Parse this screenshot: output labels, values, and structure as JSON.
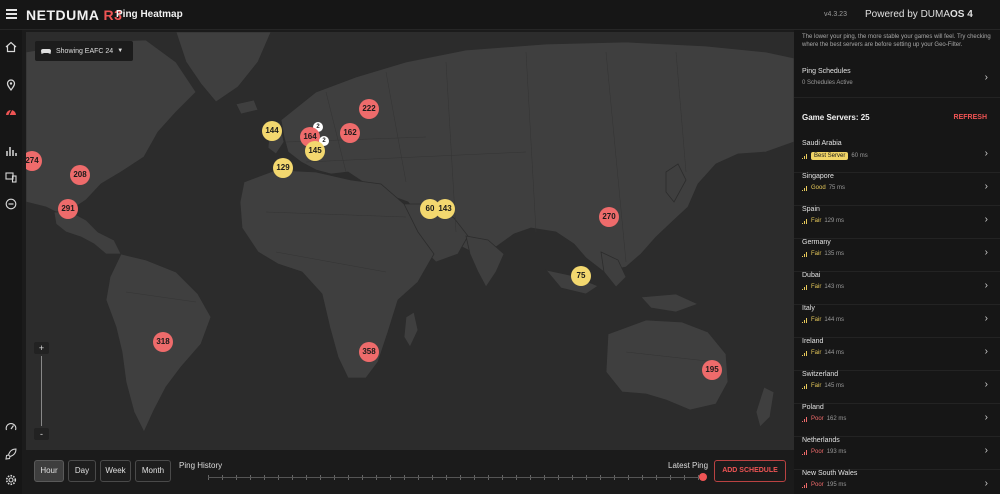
{
  "header": {
    "brand": "NETDUMA",
    "brand_model": "R3",
    "page_title": "Ping Heatmap",
    "version": "v4.3.23",
    "powered_prefix": "Powered by DUMA",
    "powered_os": "OS 4"
  },
  "map": {
    "game_selector": "Showing EAFC 24",
    "zoom_in": "+",
    "zoom_out": "-",
    "markers": [
      {
        "label": "222",
        "level": "poor"
      },
      {
        "label": "144",
        "level": "fair"
      },
      {
        "label": "2",
        "level": "cluster"
      },
      {
        "label": "164",
        "level": "poor"
      },
      {
        "label": "162",
        "level": "poor"
      },
      {
        "label": "2",
        "level": "cluster"
      },
      {
        "label": "145",
        "level": "fair"
      },
      {
        "label": "129",
        "level": "fair"
      },
      {
        "label": "274",
        "level": "poor"
      },
      {
        "label": "208",
        "level": "poor"
      },
      {
        "label": "291",
        "level": "poor"
      },
      {
        "label": "60",
        "level": "fair"
      },
      {
        "label": "143",
        "level": "fair"
      },
      {
        "label": "270",
        "level": "poor"
      },
      {
        "label": "75",
        "level": "fair"
      },
      {
        "label": "318",
        "level": "poor"
      },
      {
        "label": "358",
        "level": "poor"
      },
      {
        "label": "195",
        "level": "poor"
      }
    ]
  },
  "controls": {
    "ranges": [
      "Hour",
      "Day",
      "Week",
      "Month"
    ],
    "active_range": "Hour",
    "ping_history_label": "Ping History",
    "latest_ping_label": "Latest Ping",
    "add_schedule": "ADD SCHEDULE"
  },
  "panel": {
    "description": "The lower your ping, the more stable your games will feel. Try checking where the best servers are before setting up your Geo-Filter.",
    "schedules_title": "Ping Schedules",
    "schedules_sub": "0 Schedules Active",
    "servers_heading": "Game Servers: 25",
    "refresh": "REFRESH",
    "best_badge": "Best Server",
    "servers": [
      {
        "name": "Saudi Arabia",
        "quality": "",
        "best": true,
        "ping": "60 ms",
        "level": "fair"
      },
      {
        "name": "Singapore",
        "quality": "Good",
        "best": false,
        "ping": "75 ms",
        "level": "fair"
      },
      {
        "name": "Spain",
        "quality": "Fair",
        "best": false,
        "ping": "129 ms",
        "level": "fair"
      },
      {
        "name": "Germany",
        "quality": "Fair",
        "best": false,
        "ping": "135 ms",
        "level": "fair"
      },
      {
        "name": "Dubai",
        "quality": "Fair",
        "best": false,
        "ping": "143 ms",
        "level": "fair"
      },
      {
        "name": "Italy",
        "quality": "Fair",
        "best": false,
        "ping": "144 ms",
        "level": "fair"
      },
      {
        "name": "Ireland",
        "quality": "Fair",
        "best": false,
        "ping": "144 ms",
        "level": "fair"
      },
      {
        "name": "Switzerland",
        "quality": "Fair",
        "best": false,
        "ping": "145 ms",
        "level": "fair"
      },
      {
        "name": "Poland",
        "quality": "Poor",
        "best": false,
        "ping": "162 ms",
        "level": "poor"
      },
      {
        "name": "Netherlands",
        "quality": "Poor",
        "best": false,
        "ping": "193 ms",
        "level": "poor"
      },
      {
        "name": "New South Wales",
        "quality": "Poor",
        "best": false,
        "ping": "195 ms",
        "level": "poor"
      }
    ]
  },
  "colors": {
    "accent": "#ef5454",
    "fair": "#f3d86f",
    "poor": "#ee6b6b",
    "land": "#3f3f3f",
    "ocean": "#2c2c2c"
  }
}
